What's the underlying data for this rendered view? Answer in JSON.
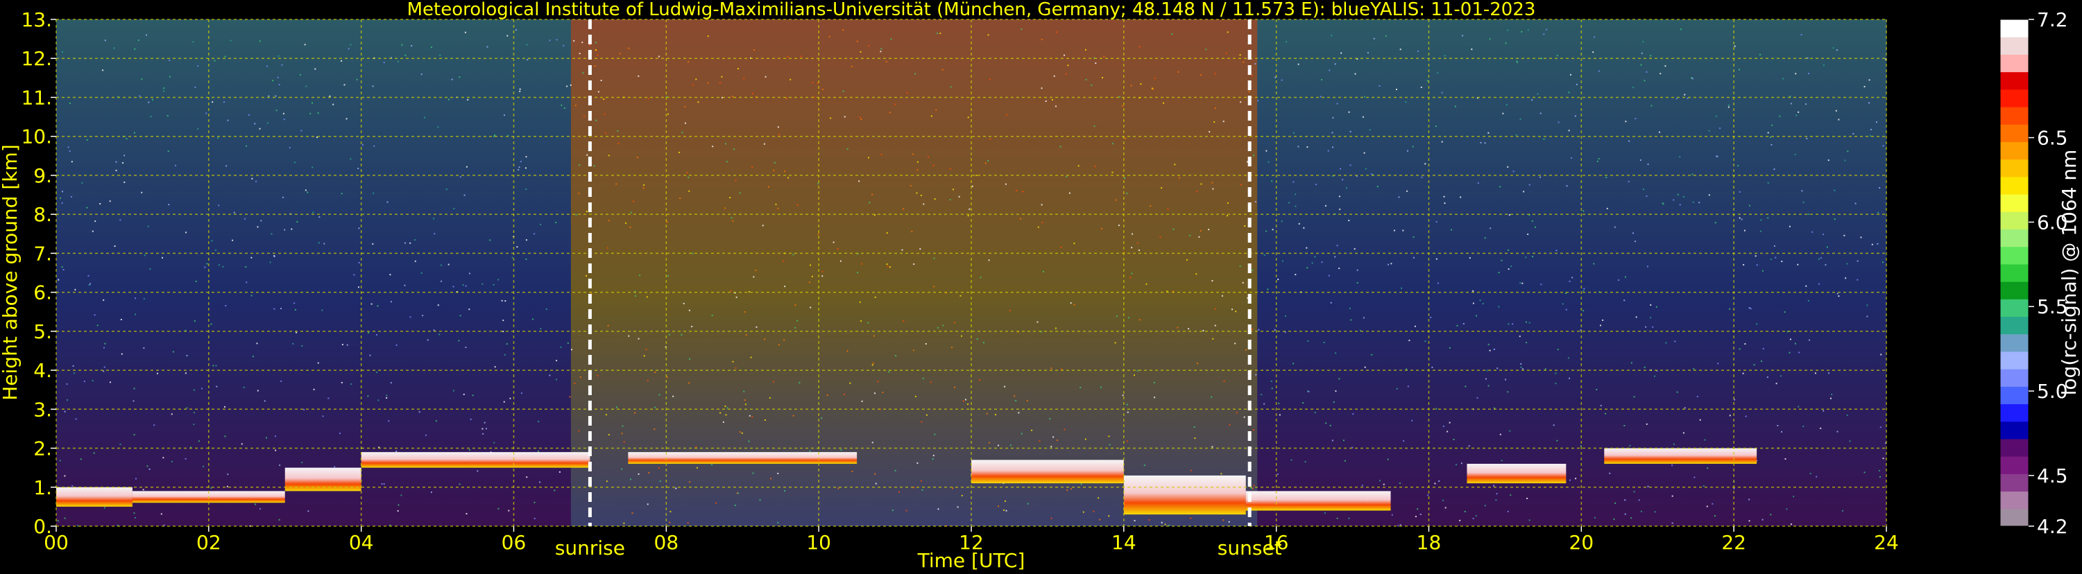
{
  "chart_data": {
    "type": "heatmap",
    "title": "Meteorological Institute of Ludwig-Maximilians-Universität (München, Germany; 48.148 N / 11.573 E):     blueYALIS: 11-01-2023",
    "xlabel": "Time [UTC]",
    "ylabel": "Height above ground [km]",
    "xlim": [
      0,
      24
    ],
    "ylim": [
      0,
      13
    ],
    "grid": true,
    "x_ticks": [
      0,
      2,
      4,
      6,
      8,
      10,
      12,
      14,
      16,
      18,
      20,
      22,
      24
    ],
    "x_tick_labels": [
      "00",
      "02",
      "04",
      "06",
      "08",
      "10",
      "12",
      "14",
      "16",
      "18",
      "20",
      "22",
      "24"
    ],
    "y_ticks": [
      0,
      1,
      2,
      3,
      4,
      5,
      6,
      7,
      8,
      9,
      10,
      11,
      12,
      13
    ],
    "y_tick_labels": [
      "0.",
      "1.",
      "2.",
      "3.",
      "4.",
      "5.",
      "6.",
      "7.",
      "8.",
      "9.",
      "10.",
      "11.",
      "12.",
      "13."
    ],
    "annotations": [
      {
        "text": "sunrise",
        "x": 7.0
      },
      {
        "text": "sunset",
        "x": 15.65
      }
    ],
    "colorbar": {
      "label": "log(rc-signal) @ 1064 nm",
      "range": [
        4.2,
        7.2
      ],
      "ticks": [
        4.2,
        4.5,
        5.0,
        5.5,
        6.0,
        6.5,
        7.2
      ],
      "tick_labels": [
        "4.2",
        "4.5",
        "5.0",
        "5.5",
        "6.0",
        "6.5",
        "7.2"
      ],
      "colors": [
        "#a08fa0",
        "#ad7fa9",
        "#8a3c8d",
        "#7a1a80",
        "#5a0b6e",
        "#0000b0",
        "#1c1cff",
        "#4a64ff",
        "#7c8cff",
        "#a0b4ff",
        "#6fa0c8",
        "#2aa88c",
        "#3cc878",
        "#0b9b1d",
        "#2ecc3a",
        "#5ee85a",
        "#9df07a",
        "#c8f45e",
        "#f5ff3a",
        "#ffe600",
        "#ffc400",
        "#ff9e00",
        "#ff7200",
        "#ff4a00",
        "#ff1a00",
        "#e00000",
        "#ffb0b0",
        "#f0d8d8",
        "#ffffff"
      ]
    },
    "series": [
      {
        "name": "cloud_layers",
        "values": [
          {
            "t0": 0.0,
            "t1": 1.0,
            "h0": 0.5,
            "h1": 1.0
          },
          {
            "t0": 1.0,
            "t1": 3.0,
            "h0": 0.6,
            "h1": 0.9
          },
          {
            "t0": 3.0,
            "t1": 4.0,
            "h0": 0.9,
            "h1": 1.5
          },
          {
            "t0": 4.0,
            "t1": 7.0,
            "h0": 1.5,
            "h1": 1.9
          },
          {
            "t0": 7.5,
            "t1": 10.5,
            "h0": 1.6,
            "h1": 1.9
          },
          {
            "t0": 12.0,
            "t1": 14.0,
            "h0": 1.1,
            "h1": 1.7
          },
          {
            "t0": 14.0,
            "t1": 15.6,
            "h0": 0.3,
            "h1": 1.3
          },
          {
            "t0": 15.6,
            "t1": 17.5,
            "h0": 0.4,
            "h1": 0.9
          },
          {
            "t0": 18.5,
            "t1": 19.8,
            "h0": 1.1,
            "h1": 1.6
          },
          {
            "t0": 20.3,
            "t1": 22.3,
            "h0": 1.6,
            "h1": 2.0
          }
        ]
      }
    ]
  }
}
